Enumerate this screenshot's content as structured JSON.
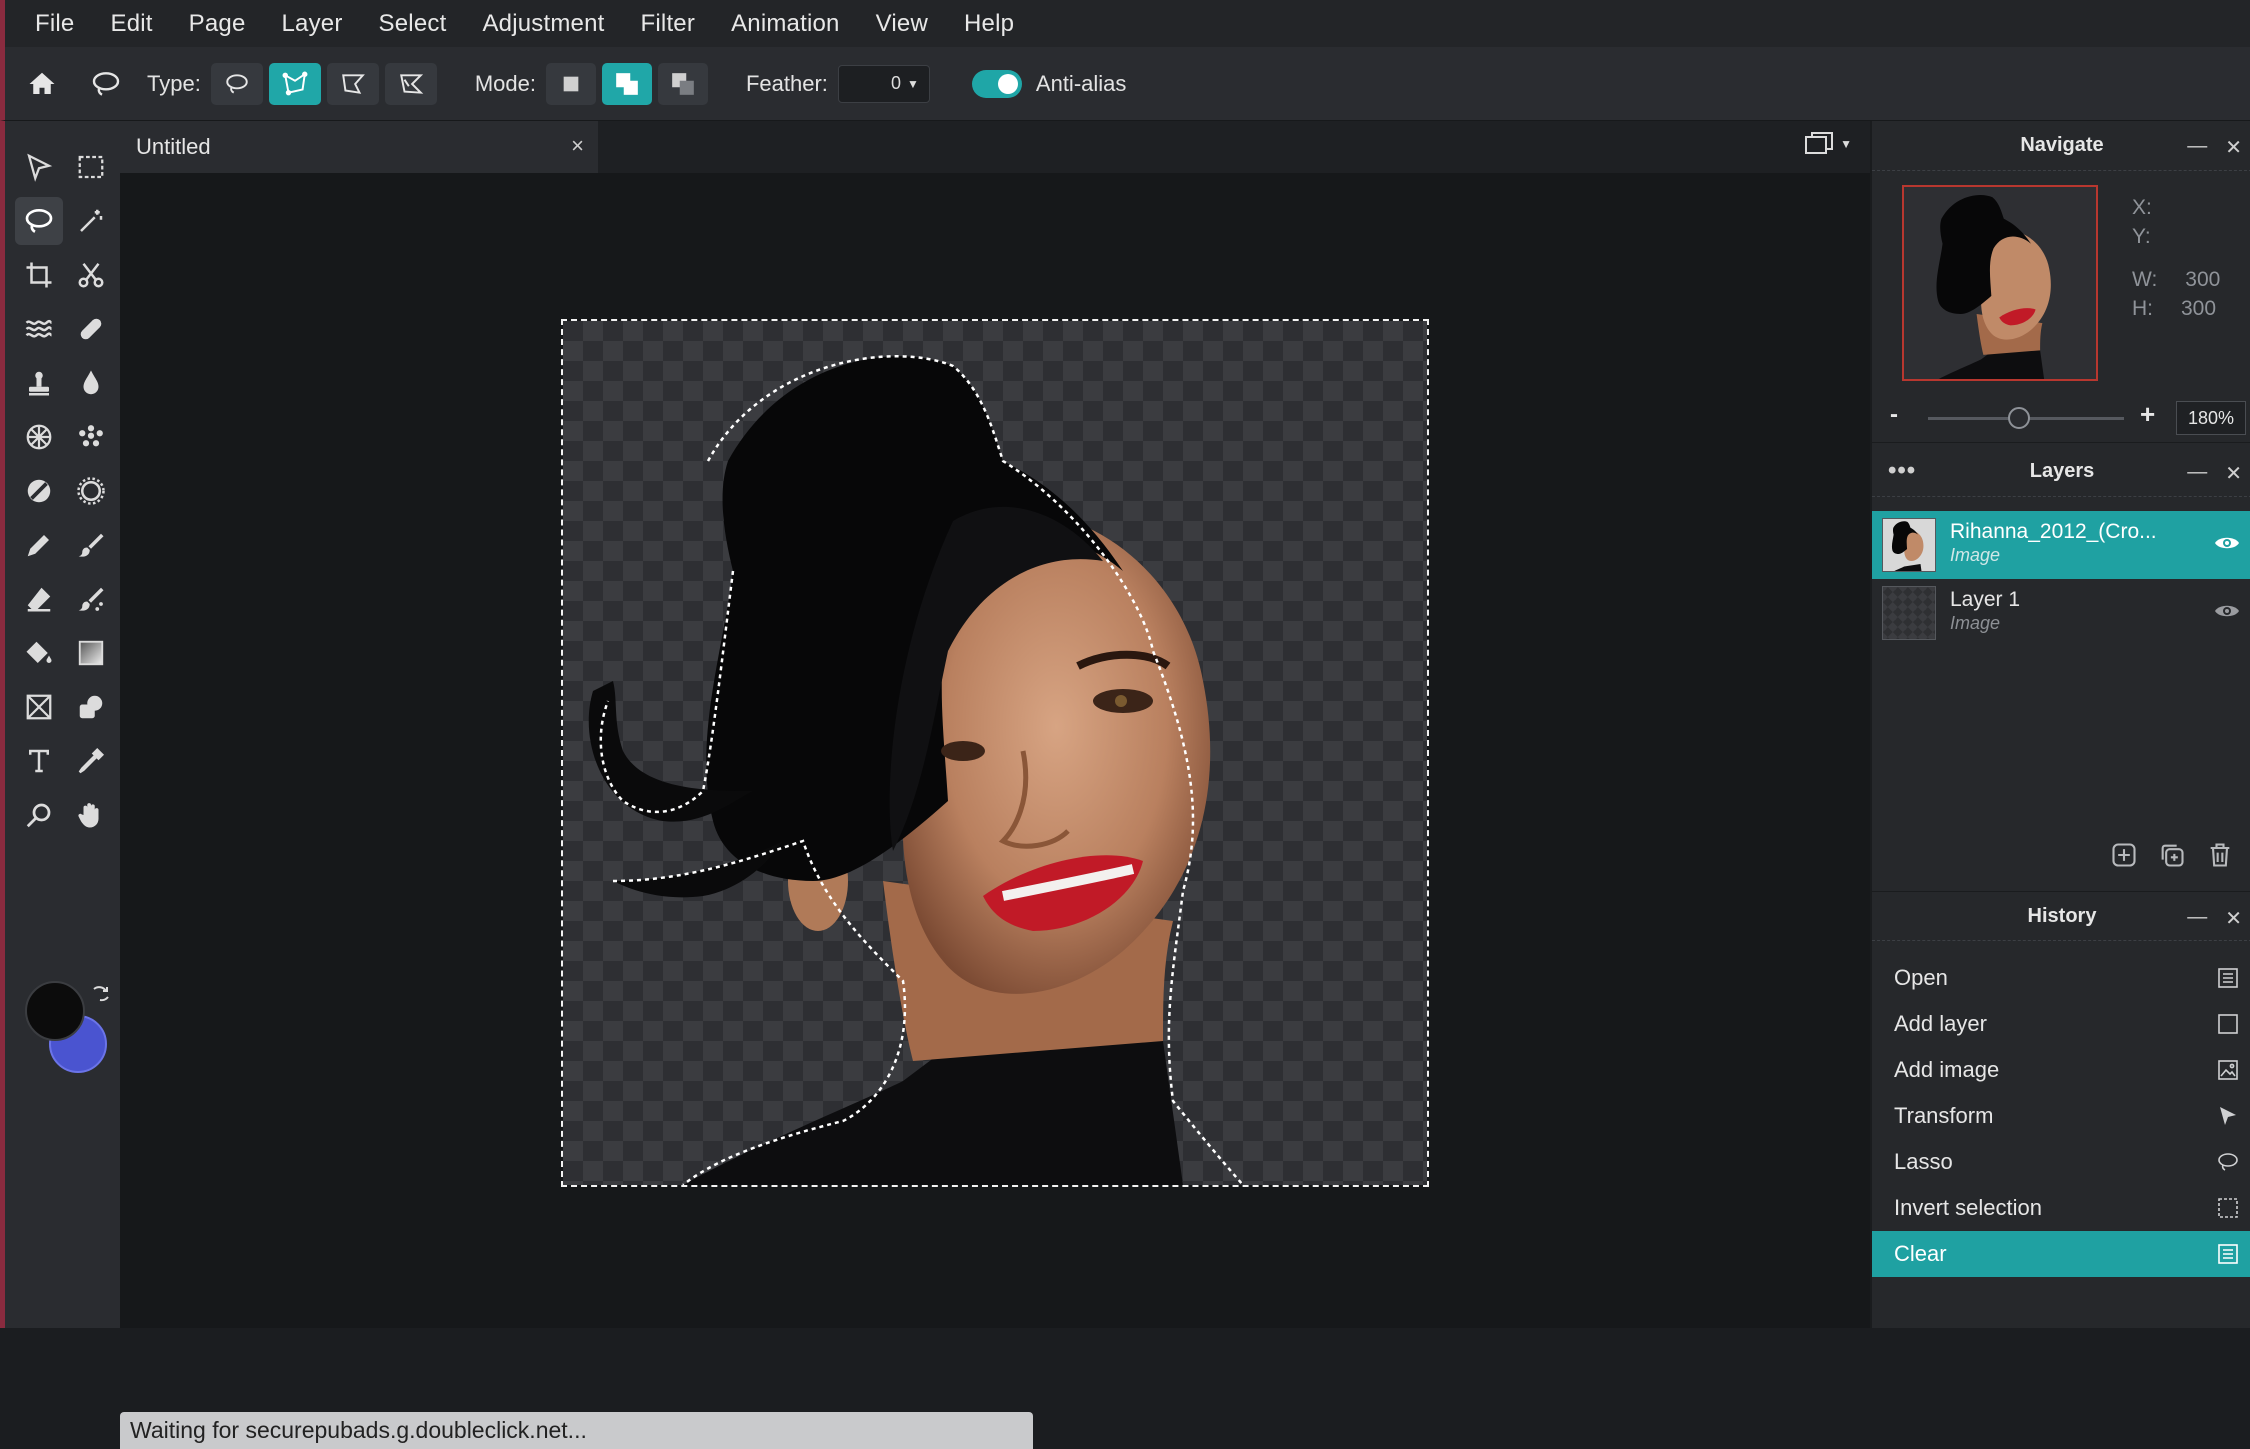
{
  "menu": [
    "File",
    "Edit",
    "Page",
    "Layer",
    "Select",
    "Adjustment",
    "Filter",
    "Animation",
    "View",
    "Help"
  ],
  "options": {
    "type_label": "Type:",
    "mode_label": "Mode:",
    "feather_label": "Feather:",
    "feather_value": "0",
    "antialias_label": "Anti-alias"
  },
  "document": {
    "tab_title": "Untitled",
    "tab_close": "×"
  },
  "status_text": "Waiting for securepubads.g.doubleclick.net...",
  "navigate": {
    "title": "Navigate",
    "x_label": "X:",
    "y_label": "Y:",
    "w_label": "W:",
    "w_value": "300",
    "h_label": "H:",
    "h_value": "300",
    "zoom_minus": "-",
    "zoom_plus": "+",
    "zoom_value": "180%"
  },
  "layers": {
    "title": "Layers",
    "items": [
      {
        "name": "Rihanna_2012_(Cro...",
        "type": "Image"
      },
      {
        "name": "Layer 1",
        "type": "Image"
      }
    ]
  },
  "history": {
    "title": "History",
    "items": [
      "Open",
      "Add layer",
      "Add image",
      "Transform",
      "Lasso",
      "Invert selection",
      "Clear"
    ]
  },
  "colors": {
    "accent": "#1fa1a2",
    "foreground": "#0c0c0c",
    "background": "#4a54d0"
  }
}
